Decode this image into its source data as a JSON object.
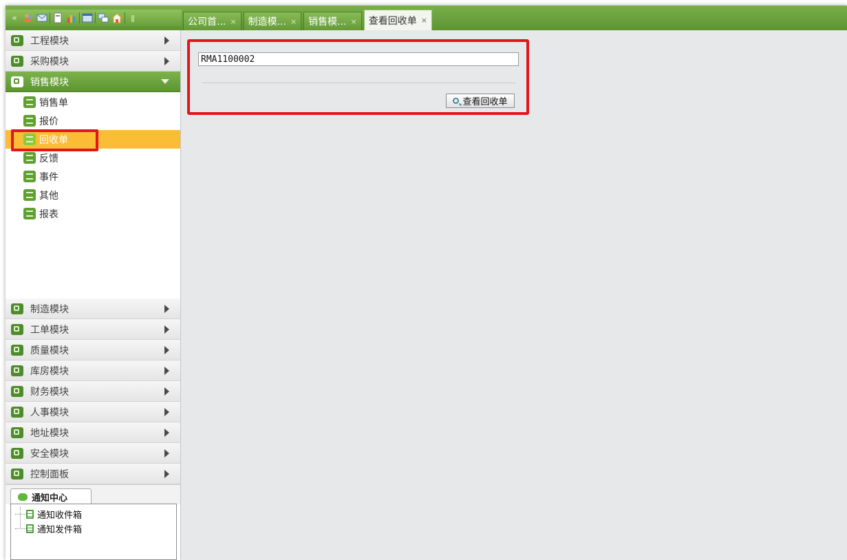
{
  "toolbar": {
    "icons": [
      "collapse-icon",
      "users-icon",
      "mail-icon",
      "document-icon",
      "chart-icon",
      "window-icon",
      "switch-icon",
      "home-icon"
    ]
  },
  "tabs": [
    {
      "label": "公司首...",
      "close": "×"
    },
    {
      "label": "制造模...",
      "close": "×"
    },
    {
      "label": "销售模...",
      "close": "×"
    },
    {
      "label": "查看回收单",
      "close": "×",
      "active": true
    }
  ],
  "sidebar": {
    "modules_top": [
      {
        "label": "工程模块"
      },
      {
        "label": "采购模块"
      },
      {
        "label": "销售模块",
        "open": true
      }
    ],
    "sales_items": [
      {
        "label": "销售单",
        "icon": "dollar-icon"
      },
      {
        "label": "报价",
        "icon": "tag-icon"
      },
      {
        "label": "回收单",
        "icon": "recycle-icon",
        "active": true
      },
      {
        "label": "反馈",
        "icon": "feedback-icon"
      },
      {
        "label": "事件",
        "icon": "book-icon"
      },
      {
        "label": "其他",
        "icon": "grid-icon"
      },
      {
        "label": "报表",
        "icon": "report-icon"
      }
    ],
    "modules_bottom": [
      {
        "label": "制造模块"
      },
      {
        "label": "工单模块"
      },
      {
        "label": "质量模块"
      },
      {
        "label": "库房模块"
      },
      {
        "label": "财务模块"
      },
      {
        "label": "人事模块"
      },
      {
        "label": "地址模块"
      },
      {
        "label": "安全模块"
      },
      {
        "label": "控制面板"
      }
    ]
  },
  "notifications": {
    "tab_label": "通知中心",
    "items": [
      {
        "label": "通知收件箱"
      },
      {
        "label": "通知发件箱"
      }
    ]
  },
  "main": {
    "rma_value": "RMA1100002",
    "view_button": "查看回收单"
  },
  "colors": {
    "accent_green": "#6aa03c",
    "active_item": "#fbbd36",
    "highlight_red": "#e3151a"
  }
}
